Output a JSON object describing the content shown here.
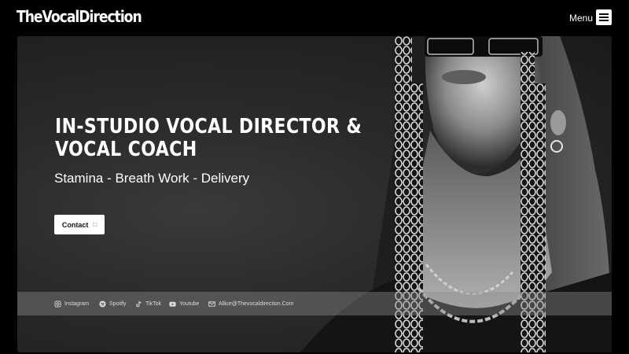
{
  "header": {
    "logo": "TheVocalDirection",
    "menu_label": "Menu"
  },
  "hero": {
    "headline_line1": "IN-STUDIO VOCAL DIRECTOR &",
    "headline_line2": "VOCAL COACH",
    "subline": "Stamina - Breath Work - Delivery",
    "contact_label": "Contact"
  },
  "social": {
    "instagram": "Instagram",
    "spotify": "Spotify",
    "tiktok": "TikTok",
    "youtube": "Youtube",
    "email": "Allice@Thevocaldirection.Com"
  },
  "colors": {
    "background": "#000000",
    "hero_bg": "#2a2a2a",
    "button_bg": "#ffffff"
  }
}
